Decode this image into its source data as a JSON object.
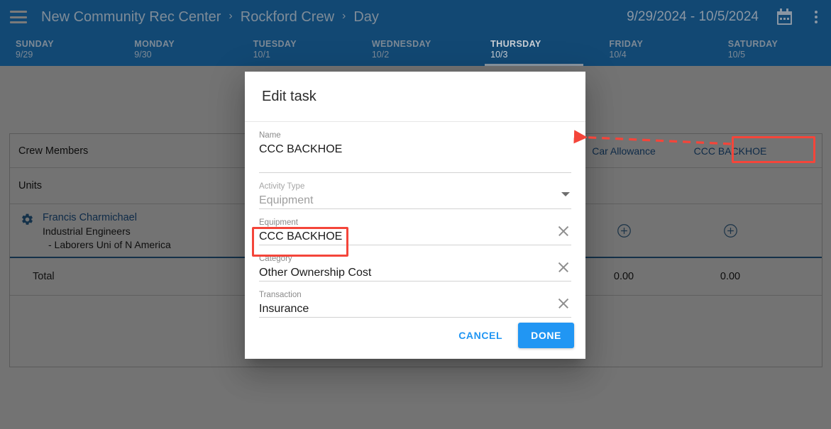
{
  "appbar": {
    "menu_icon": "hamburger-menu-icon",
    "breadcrumb": [
      "New Community Rec Center",
      "Rockford Crew",
      "Day"
    ],
    "separator": "›",
    "date_range": "9/29/2024 - 10/5/2024",
    "calendar_icon": "calendar-icon",
    "overflow_icon": "kebab-menu-icon"
  },
  "days": [
    {
      "name": "SUNDAY",
      "date": "9/29",
      "active": false
    },
    {
      "name": "MONDAY",
      "date": "9/30",
      "active": false
    },
    {
      "name": "TUESDAY",
      "date": "10/1",
      "active": false
    },
    {
      "name": "WEDNESDAY",
      "date": "10/2",
      "active": false
    },
    {
      "name": "THURSDAY",
      "date": "10/3",
      "active": true
    },
    {
      "name": "FRIDAY",
      "date": "10/4",
      "active": false
    },
    {
      "name": "SATURDAY",
      "date": "10/5",
      "active": false
    }
  ],
  "grid": {
    "crew_members_label": "Crew Members",
    "units_label": "Units",
    "columns": [
      {
        "label": "Car Allowance",
        "highlighted": false
      },
      {
        "label": "CCC BACKHOE",
        "highlighted": true
      }
    ],
    "member": {
      "gear_icon": "gear-icon",
      "name": "Francis Charmichael",
      "craft": "Industrial Engineers",
      "union": "- Laborers Uni of N America",
      "add_icon": "plus-circle-icon"
    },
    "total": {
      "label": "Total",
      "values": [
        "0.00",
        "0.00"
      ]
    }
  },
  "dialog": {
    "title": "Edit task",
    "fields": [
      {
        "label": "Name",
        "value": "CCC BACKHOE",
        "control": "none",
        "disabled": false,
        "highlighted": false
      },
      {
        "label": "Activity Type",
        "value": "Equipment",
        "control": "caret",
        "disabled": true,
        "highlighted": false
      },
      {
        "label": "Equipment",
        "value": "CCC BACKHOE",
        "control": "clear",
        "disabled": false,
        "highlighted": true
      },
      {
        "label": "Category",
        "value": "Other Ownership Cost",
        "control": "clear",
        "disabled": false,
        "highlighted": false
      },
      {
        "label": "Transaction",
        "value": "Insurance",
        "control": "clear",
        "disabled": false,
        "highlighted": false
      }
    ],
    "cancel_label": "CANCEL",
    "done_label": "DONE"
  },
  "annotation": {
    "color": "#f4453a",
    "arrow": "dashed-arrow-pointing-left",
    "target_column": "CCC BACKHOE",
    "target_field": "Equipment"
  },
  "colors": {
    "appbar": "#124873",
    "accent_blue": "#2196f3",
    "link_blue": "#2361a0",
    "annotation_red": "#f4453a"
  }
}
